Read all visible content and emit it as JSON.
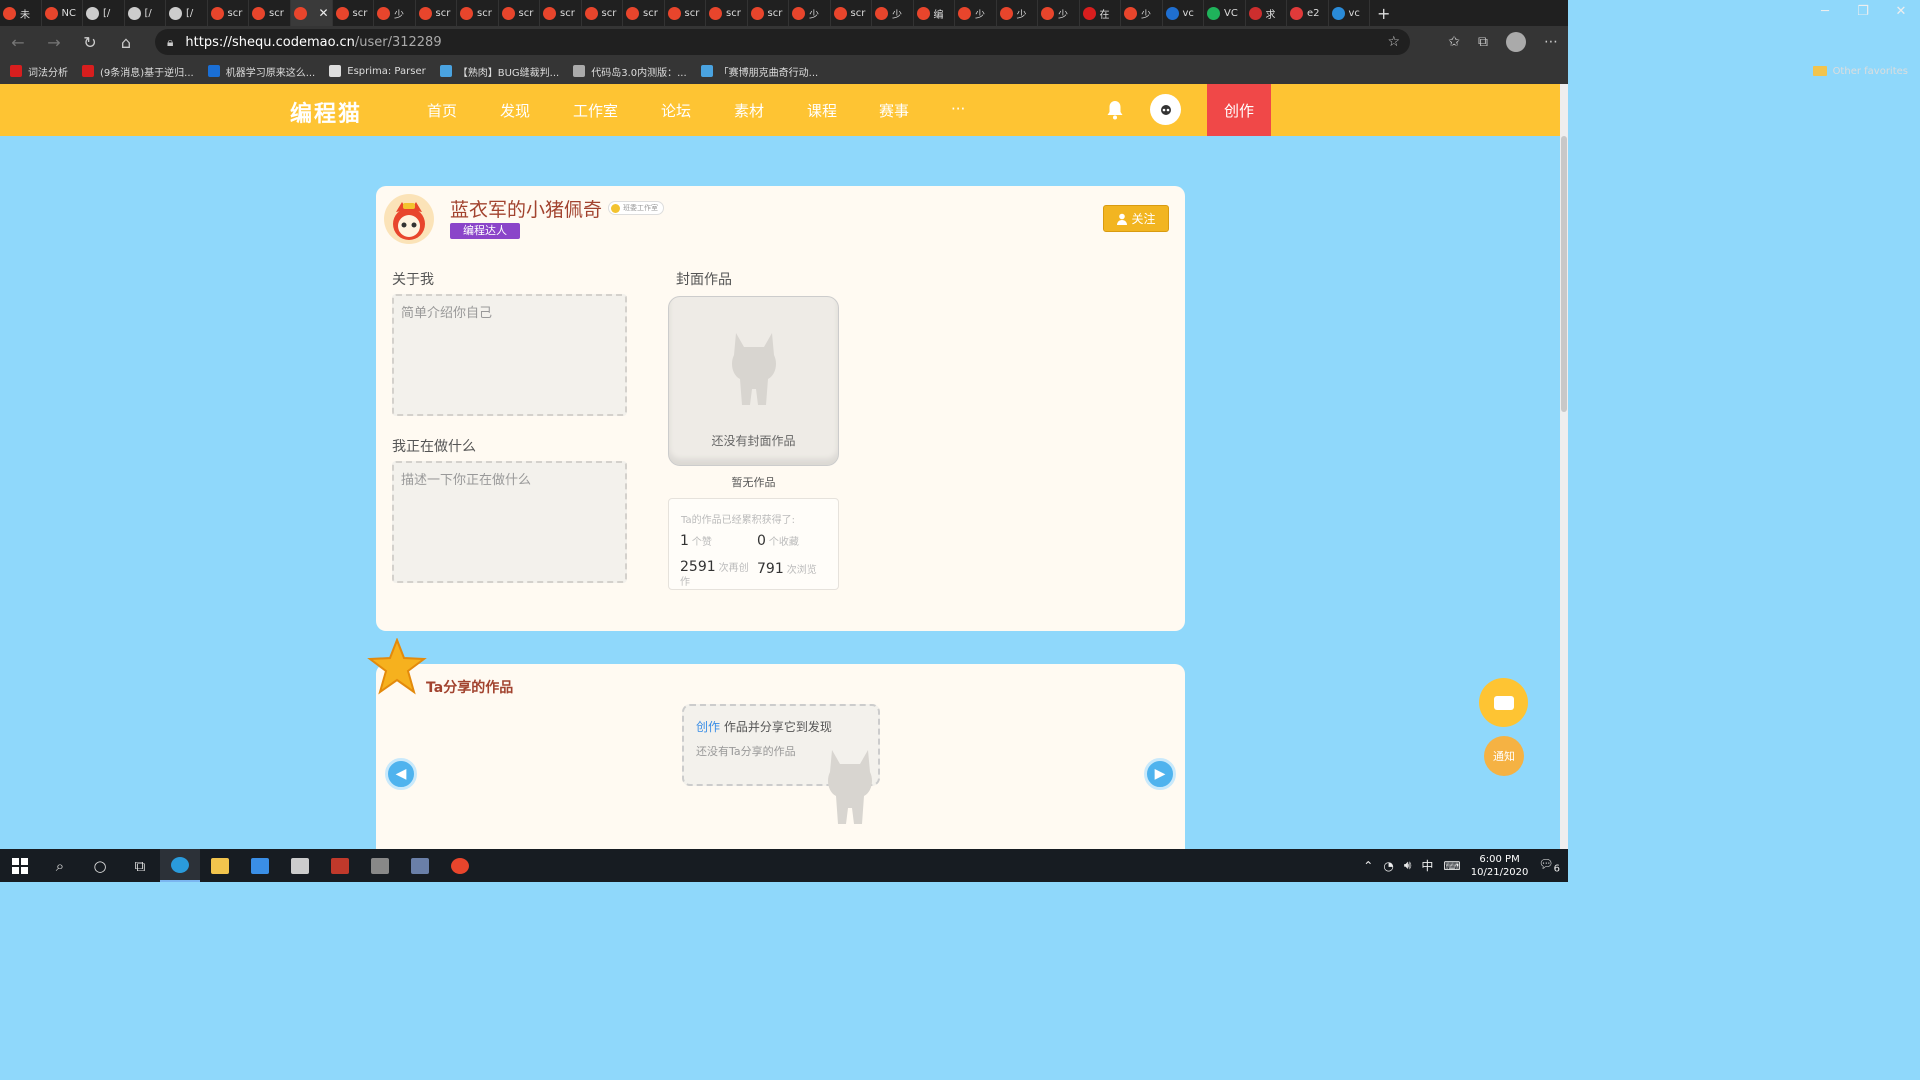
{
  "browser": {
    "tabs": [
      {
        "label": "未",
        "color": "#e8452c"
      },
      {
        "label": "NC",
        "color": "#e8452c"
      },
      {
        "label": "[/",
        "color": "#cccccc"
      },
      {
        "label": "[/",
        "color": "#cccccc"
      },
      {
        "label": "[/",
        "color": "#cccccc"
      },
      {
        "label": "scr",
        "color": "#e8452c"
      },
      {
        "label": "scr",
        "color": "#e8452c"
      },
      {
        "label": "",
        "color": "#e8452c",
        "active": true
      },
      {
        "label": "scr",
        "color": "#e8452c"
      },
      {
        "label": "少",
        "color": "#e8452c"
      },
      {
        "label": "scr",
        "color": "#e8452c"
      },
      {
        "label": "scr",
        "color": "#e8452c"
      },
      {
        "label": "scr",
        "color": "#e8452c"
      },
      {
        "label": "scr",
        "color": "#e8452c"
      },
      {
        "label": "scr",
        "color": "#e8452c"
      },
      {
        "label": "scr",
        "color": "#e8452c"
      },
      {
        "label": "scr",
        "color": "#e8452c"
      },
      {
        "label": "scr",
        "color": "#e8452c"
      },
      {
        "label": "scr",
        "color": "#e8452c"
      },
      {
        "label": "少",
        "color": "#e8452c"
      },
      {
        "label": "scr",
        "color": "#e8452c"
      },
      {
        "label": "少",
        "color": "#e8452c"
      },
      {
        "label": "编",
        "color": "#e8452c"
      },
      {
        "label": "少",
        "color": "#e8452c"
      },
      {
        "label": "少",
        "color": "#e8452c"
      },
      {
        "label": "少",
        "color": "#e8452c"
      },
      {
        "label": "在",
        "color": "#d81e1e"
      },
      {
        "label": "少",
        "color": "#e8452c"
      },
      {
        "label": "vc",
        "color": "#1f6fd1"
      },
      {
        "label": "VC",
        "color": "#1fb35b"
      },
      {
        "label": "求",
        "color": "#cc2e2e"
      },
      {
        "label": "e2",
        "color": "#e03a3a"
      },
      {
        "label": "vc",
        "color": "#2a8bd8"
      }
    ],
    "new_tab_glyph": "+",
    "close_glyph": "✕",
    "window_controls": [
      "─",
      "❐",
      "✕"
    ],
    "url_host": "https://shequ.codemao.cn",
    "url_path": "/user/312289",
    "bookmarks": [
      {
        "label": "词法分析",
        "color": "#d81e1e"
      },
      {
        "label": "(9条消息)基于逆归...",
        "color": "#d81e1e"
      },
      {
        "label": "机器学习原来这么...",
        "color": "#1a6fd6"
      },
      {
        "label": "Esprima: Parser",
        "color": "#dddddd"
      },
      {
        "label": "【熟肉】BUG缝裁判...",
        "color": "#4aa3e0"
      },
      {
        "label": "代码岛3.0内测版：...",
        "color": "#aaaaaa"
      },
      {
        "label": "「赛博朋克曲奇行动...",
        "color": "#4aa3e0"
      }
    ],
    "other_favorites": "Other favorites"
  },
  "site": {
    "logo": "编程猫",
    "nav": [
      "首页",
      "发现",
      "工作室",
      "论坛",
      "素材",
      "课程",
      "赛事",
      "···"
    ],
    "create_label": "创作",
    "accent": "#fec433"
  },
  "profile": {
    "username": "蓝衣军的小猪佩奇",
    "studio_tag": "班委工作室",
    "badge": "编程达人",
    "follow_label": "关注",
    "about_title": "关于我",
    "about_placeholder": "简单介绍你自己",
    "doing_title": "我正在做什么",
    "doing_placeholder": "描述一下你正在做什么",
    "cover_title": "封面作品",
    "cover_empty": "还没有封面作品",
    "no_work": "暂无作品",
    "stats_title": "Ta的作品已经累积获得了:",
    "likes": "1",
    "likes_label": "个赞",
    "favorites": "0",
    "favorites_label": "个收藏",
    "recreations": "2591",
    "recreations_label": "次再创作",
    "views": "791",
    "views_label": "次浏览"
  },
  "shared": {
    "title": "Ta分享的作品",
    "create_link": "创作",
    "line1_rest": "作品并分享它到发现",
    "line2": "还没有Ta分享的作品"
  },
  "float": {
    "notice_label": "通知"
  },
  "taskbar": {
    "time": "6:00 PM",
    "date": "10/21/2020",
    "ime": "中",
    "notif_count": "6"
  }
}
